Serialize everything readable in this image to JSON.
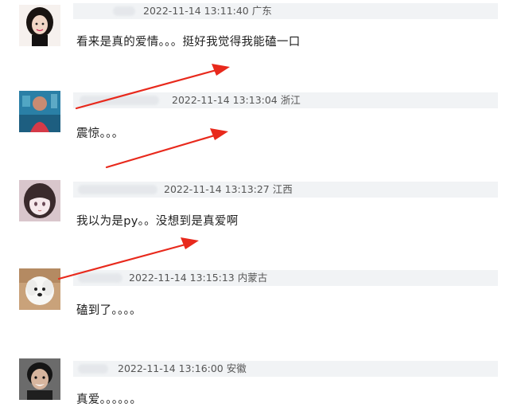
{
  "comments": [
    {
      "timestamp": "2022-11-14 13:11:40",
      "location": "广东",
      "text": "看来是真的爱情。。。挺好我觉得我能磕一口",
      "avatar_icon": "woman-portrait-avatar"
    },
    {
      "timestamp": "2022-11-14 13:13:04",
      "location": "浙江",
      "text": "震惊。。。",
      "avatar_icon": "blue-photo-avatar"
    },
    {
      "timestamp": "2022-11-14 13:13:27",
      "location": "江西",
      "text": "我以为是py。。没想到是真爱啊",
      "avatar_icon": "anime-girl-avatar"
    },
    {
      "timestamp": "2022-11-14 13:15:13",
      "location": "内蒙古",
      "text": "磕到了。。。。",
      "avatar_icon": "white-dog-avatar"
    },
    {
      "timestamp": "2022-11-14 13:16:00",
      "location": "安徽",
      "text": "真爱。。。。。。",
      "avatar_icon": "man-portrait-avatar"
    }
  ],
  "colors": {
    "meta_bar": "#f1f3f5",
    "arrow": "#e8291c",
    "text": "#1f1f1f",
    "meta_text": "#555555"
  }
}
